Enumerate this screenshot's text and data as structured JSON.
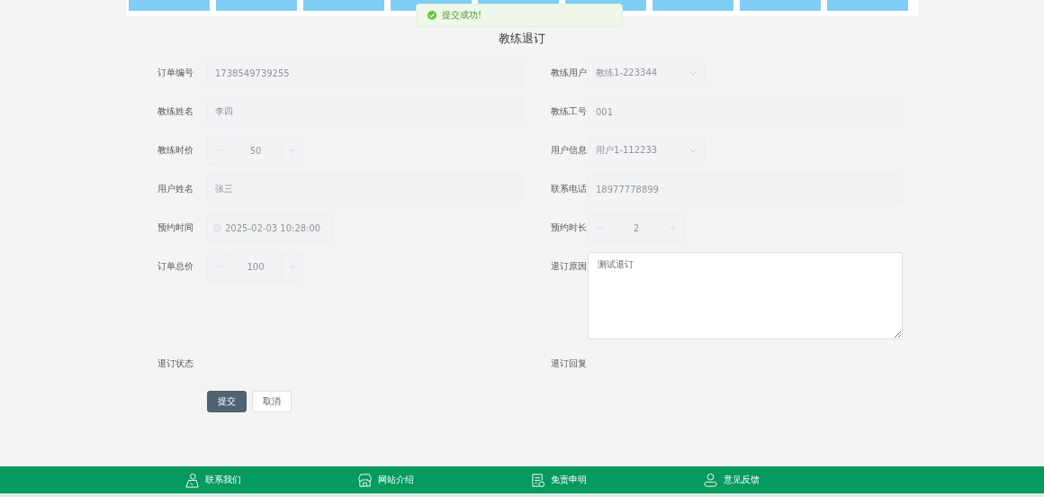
{
  "nav": {
    "tabs": [
      {
        "selected": false
      },
      {
        "selected": false
      },
      {
        "selected": false
      },
      {
        "selected": false
      },
      {
        "selected": false
      },
      {
        "selected": false
      },
      {
        "selected": false
      },
      {
        "selected": false
      },
      {
        "selected": false
      }
    ]
  },
  "toast": {
    "text": "提交成功!"
  },
  "form": {
    "title": "教练退订",
    "rows": [
      [
        {
          "label": "订单编号",
          "kind": "text",
          "value": "1738549739255",
          "disabled": true
        },
        {
          "label": "教练用户",
          "kind": "select",
          "value": "教练1-223344",
          "disabled": true
        }
      ],
      [
        {
          "label": "教练姓名",
          "kind": "text",
          "value": "李四",
          "disabled": true
        },
        {
          "label": "教练工号",
          "kind": "text",
          "value": "001",
          "disabled": true
        }
      ],
      [
        {
          "label": "教练时价",
          "kind": "number",
          "value": "50",
          "disabled": true
        },
        {
          "label": "用户信息",
          "kind": "select",
          "value": "用户1-112233",
          "disabled": true
        }
      ],
      [
        {
          "label": "用户姓名",
          "kind": "text",
          "value": "张三",
          "disabled": true
        },
        {
          "label": "联系电话",
          "kind": "text",
          "value": "18977778899",
          "disabled": true
        }
      ],
      [
        {
          "label": "预约时间",
          "kind": "date",
          "value": "2025-02-03 10:28:00",
          "disabled": true
        },
        {
          "label": "预约时长",
          "kind": "number",
          "value": "2",
          "disabled": true
        }
      ],
      [
        {
          "label": "订单总价",
          "kind": "number",
          "value": "100",
          "disabled": true
        },
        {
          "label": "退订原因",
          "kind": "textarea",
          "value": "测试退订",
          "disabled": false
        }
      ],
      [
        {
          "label": "退订状态",
          "kind": "none"
        },
        {
          "label": "退订回复",
          "kind": "none"
        }
      ]
    ],
    "buttons": [
      {
        "label": "提交",
        "kind": "primary"
      },
      {
        "label": "取消",
        "kind": "plain"
      }
    ]
  },
  "footer": {
    "links": [
      {
        "label": "联系我们",
        "kind": "contact"
      },
      {
        "label": "网站介绍",
        "kind": "about"
      },
      {
        "label": "免责申明",
        "kind": "disclaimer"
      },
      {
        "label": "意见反馈",
        "kind": "feedback"
      }
    ]
  }
}
